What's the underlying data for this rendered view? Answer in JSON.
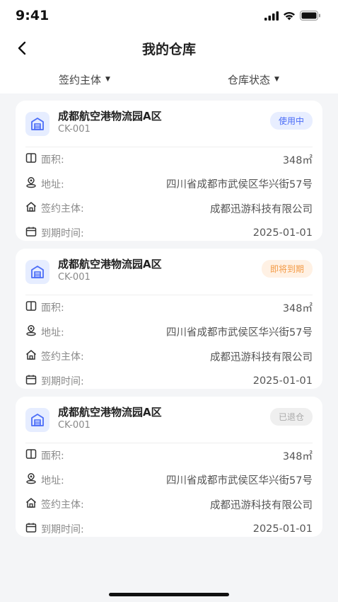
{
  "status_bar": {
    "time": "9:41"
  },
  "nav": {
    "title": "我的仓库"
  },
  "filters": [
    {
      "label": "签约主体"
    },
    {
      "label": "仓库状态"
    }
  ],
  "cards": [
    {
      "name": "成都航空港物流园A区",
      "code": "CK-001",
      "status": "使用中",
      "status_type": "inuse",
      "rows": [
        {
          "label": "面积:",
          "value": "348㎡"
        },
        {
          "label": "地址:",
          "value": "四川省成都市武侯区华兴街57号"
        },
        {
          "label": "签约主体:",
          "value": "成都迅游科技有限公司"
        },
        {
          "label": "到期时间:",
          "value": "2025-01-01"
        }
      ]
    },
    {
      "name": "成都航空港物流园A区",
      "code": "CK-001",
      "status": "即将到期",
      "status_type": "expiring",
      "rows": [
        {
          "label": "面积:",
          "value": "348㎡"
        },
        {
          "label": "地址:",
          "value": "四川省成都市武侯区华兴街57号"
        },
        {
          "label": "签约主体:",
          "value": "成都迅游科技有限公司"
        },
        {
          "label": "到期时间:",
          "value": "2025-01-01"
        }
      ]
    },
    {
      "name": "成都航空港物流园A区",
      "code": "CK-001",
      "status": "已退仓",
      "status_type": "returned",
      "rows": [
        {
          "label": "面积:",
          "value": "348㎡"
        },
        {
          "label": "地址:",
          "value": "四川省成都市武侯区华兴街57号"
        },
        {
          "label": "签约主体:",
          "value": "成都迅游科技有限公司"
        },
        {
          "label": "到期时间:",
          "value": "2025-01-01"
        }
      ]
    }
  ],
  "colors": {
    "accent": "#4a6cf7",
    "inuse_bg": "#e8eeff",
    "expiring": "#f39a45",
    "expiring_bg": "#fff1e4",
    "returned": "#aaaaaa",
    "returned_bg": "#efefef",
    "background": "#f4f5f7"
  },
  "icons": {
    "row_icons": [
      "area-icon",
      "location-icon",
      "home-icon",
      "calendar-icon"
    ],
    "card_icon": "warehouse-icon"
  }
}
